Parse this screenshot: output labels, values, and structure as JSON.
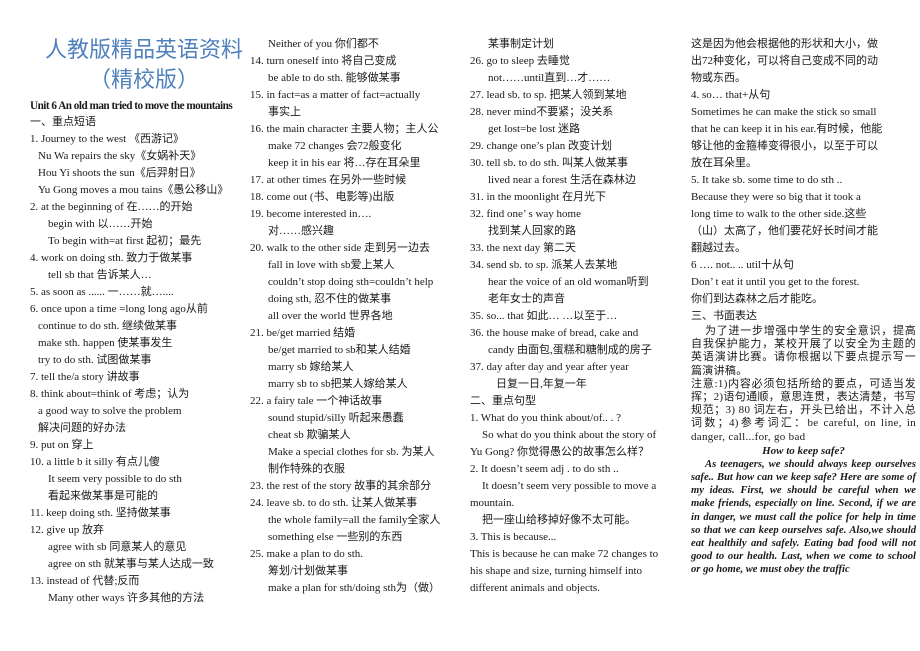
{
  "header": {
    "title": "人教版精品英语资料",
    "subtitle": "（精校版）",
    "unit_title": "Unit 6 An old man tried to move the mountains"
  },
  "colors": {
    "title": "#4f81bd",
    "text": "#1a1a1a"
  },
  "column1": [
    {
      "text": "一、重点短语",
      "indent": 0
    },
    {
      "text": "1. Journey to the west  《西游记》",
      "indent": 0
    },
    {
      "text": "Nu Wa repairs the sky《女娲补天》",
      "indent": 1
    },
    {
      "text": "Hou Yi shoots the sun《后羿射日》",
      "indent": 1
    },
    {
      "text": "Yu Gong moves a mou tains《愚公移山》",
      "indent": 1
    },
    {
      "text": "2. at the beginning of  在……的开始",
      "indent": 0
    },
    {
      "text": "begin with  以……开始",
      "indent": 2
    },
    {
      "text": "To begin with=at first  起初；最先",
      "indent": 2
    },
    {
      "text": "4. work on doing sth. 致力于做某事",
      "indent": 0
    },
    {
      "text": "tell sb that  告诉某人…",
      "indent": 2
    },
    {
      "text": "5. as soon as ......  一……就…....",
      "indent": 0
    },
    {
      "text": "6. once upon a time =long long ago从前",
      "indent": 0
    },
    {
      "text": "continue to do sth.  继续做某事",
      "indent": 1
    },
    {
      "text": "make sth. happen  使某事发生",
      "indent": 1
    },
    {
      "text": "try to do sth.  试图做某事",
      "indent": 1
    },
    {
      "text": "7. tell the/a story  讲故事",
      "indent": 0
    },
    {
      "text": "8. think about=think of  考虑；认为",
      "indent": 0
    },
    {
      "text": "a good way to solve the problem",
      "indent": 1
    },
    {
      "text": "解决问题的好办法",
      "indent": 1
    },
    {
      "text": "9. put on  穿上",
      "indent": 0
    },
    {
      "text": "10. a little b it silly  有点儿傻",
      "indent": 0
    },
    {
      "text": "It seem very possible to do sth",
      "indent": 2
    },
    {
      "text": "看起来做某事是可能的",
      "indent": 2
    },
    {
      "text": "11. keep doing sth.  坚持做某事",
      "indent": 0
    },
    {
      "text": "12. give up  放弃",
      "indent": 0
    },
    {
      "text": "agree with sb  同意某人的意见",
      "indent": 2
    },
    {
      "text": "agree on sth  就某事与某人达成一致",
      "indent": 2
    },
    {
      "text": "13. instead of  代替;反而",
      "indent": 0
    },
    {
      "text": "Many other ways  许多其他的方法",
      "indent": 2
    }
  ],
  "column2": [
    {
      "text": "Neither of you  你们都不",
      "indent": 1
    },
    {
      "text": "14. turn oneself into  将自己变成",
      "indent": 0
    },
    {
      "text": "be able to do sth.  能够做某事",
      "indent": 2
    },
    {
      "text": "15. in fact=as a matter of fact=actually",
      "indent": 0
    },
    {
      "text": "事实上",
      "indent": 1
    },
    {
      "text": "16. the main character  主要人物；主人公",
      "indent": 0
    },
    {
      "text": "make 72 changes  会72般变化",
      "indent": 1
    },
    {
      "text": "keep it in his ear  将…存在耳朵里",
      "indent": 1
    },
    {
      "text": "17. at other times  在另外一些时候",
      "indent": 0
    },
    {
      "text": "18. come out (书、电影等)出版",
      "indent": 0
    },
    {
      "text": "19. become interested in….",
      "indent": 0
    },
    {
      "text": "对……感兴趣",
      "indent": 1
    },
    {
      "text": "20. walk to the other side  走到另一边去",
      "indent": 0
    },
    {
      "text": "fall in love with sb爱上某人",
      "indent": 1
    },
    {
      "text": "couldn’t stop doing sth=couldn’t help",
      "indent": 1
    },
    {
      "text": "doing sth,  忍不住的做某事",
      "indent": 1
    },
    {
      "text": "all over the world  世界各地",
      "indent": 1
    },
    {
      "text": "21. be/get married  结婚",
      "indent": 0
    },
    {
      "text": "be/get married to sb和某人结婚",
      "indent": 1
    },
    {
      "text": "marry sb  嫁给某人",
      "indent": 1
    },
    {
      "text": "marry sb to sb把某人嫁给某人",
      "indent": 1
    },
    {
      "text": "22. a fairy tale  一个神话故事",
      "indent": 0
    },
    {
      "text": "sound stupid/silly  听起来愚蠢",
      "indent": 1
    },
    {
      "text": "cheat sb  欺骗某人",
      "indent": 1
    },
    {
      "text": "Make a special clothes for sb.  为某人",
      "indent": 1
    },
    {
      "text": "制作特殊的衣服",
      "indent": 1
    },
    {
      "text": "23. the rest of the story  故事的其余部分",
      "indent": 0
    },
    {
      "text": "24. leave sb. to do sth.  让某人做某事",
      "indent": 0
    },
    {
      "text": "the whole family=all the family全家人",
      "indent": 1
    },
    {
      "text": "something else  一些别的东西",
      "indent": 1
    },
    {
      "text": "25. make a plan to do sth.",
      "indent": 0
    },
    {
      "text": "筹划/计划做某事",
      "indent": 1
    },
    {
      "text": "make a plan for sth/doing sth为（做）",
      "indent": 1
    }
  ],
  "column3": [
    {
      "text": "某事制定计划",
      "indent": 1
    },
    {
      "text": "26. go to sleep  去睡觉",
      "indent": 0
    },
    {
      "text": "not……until直到…才……",
      "indent": 1
    },
    {
      "text": "27. lead sb. to sp.  把某人领到某地",
      "indent": 0
    },
    {
      "text": "28. never mind不要紧；没关系",
      "indent": 0
    },
    {
      "text": "get lost=be lost  迷路",
      "indent": 1
    },
    {
      "text": "29. change one’s plan  改变计划",
      "indent": 0
    },
    {
      "text": "30. tell sb. to do sth.  叫某人做某事",
      "indent": 0
    },
    {
      "text": "lived near a forest  生活在森林边",
      "indent": 1
    },
    {
      "text": "31. in the moonlight  在月光下",
      "indent": 0
    },
    {
      "text": "32. find one’ s way home",
      "indent": 0
    },
    {
      "text": "找到某人回家的路",
      "indent": 1
    },
    {
      "text": "33. the next day  第二天",
      "indent": 0
    },
    {
      "text": "34. send sb. to sp.  派某人去某地",
      "indent": 0
    },
    {
      "text": "hear the voice of an old woman听到",
      "indent": 1
    },
    {
      "text": "老年女士的声音",
      "indent": 1
    },
    {
      "text": "35. so... that  如此… …以至于…",
      "indent": 0
    },
    {
      "text": "36. the house make of bread, cake and",
      "indent": 0
    },
    {
      "text": "candy 由面包,蛋糕和糖制成的房子",
      "indent": 1
    },
    {
      "text": "37. day after day and year after year",
      "indent": 0
    },
    {
      "text": "日复一日,年复一年",
      "indent": 3
    },
    {
      "text": "二、重点句型",
      "indent": 0
    },
    {
      "text": "1. What do you think about/of.. . ?",
      "indent": 0
    },
    {
      "text": "So what do you think about the story of",
      "indent": 4
    },
    {
      "text": "Yu Gong?  你觉得愚公的故事怎么样？",
      "indent": 0
    },
    {
      "text": "2. It doesn’t seem adj . to do sth ..",
      "indent": 0
    },
    {
      "text": "It doesn’t seem very possible to move a",
      "indent": 4
    },
    {
      "text": "mountain.",
      "indent": 0
    },
    {
      "text": "把一座山给移掉好像不太可能。",
      "indent": 4
    },
    {
      "text": "3. This is because...",
      "indent": 0
    },
    {
      "text": "This is because he can make 72 changes to",
      "indent": 0
    },
    {
      "text": "his shape and size, turning himself into",
      "indent": 0
    },
    {
      "text": "different animals and objects.",
      "indent": 0
    }
  ],
  "column4": {
    "lines": [
      "这是因为他会根据他的形状和大小，做",
      "出72种变化，可以将自己变成不同的动",
      "物或东西。",
      "4. so… that+从句",
      "Sometimes he can make the stick so small",
      "that he can keep it in his ear.有时候，他能",
      "够让他的金箍棒变得很小，以至于可以",
      "放在耳朵里。",
      "5. It take sb. some time to do sth ..",
      "Because they were so big that it took a",
      "long time to walk to the other side.这些",
      "（山）太高了，他们要花好长时间才能",
      "翻越过去。",
      "6 …. not.. .. util十从句",
      "Don’ t eat it until you get to the forest.",
      "你们到达森林之后才能吃。",
      "三、书面表达"
    ],
    "instruction": "为了进一步增强中学生的安全意识，提高自我保护能力，某校开展了以安全为主题的英语演讲比赛。请你根据以下要点提示写一篇演讲稿。",
    "notes": "注意:1)内容必须包括所给的要点，可适当发挥；2)语句通顺，意思连贯，表达清楚，书写规范；3) 80 词左右，开头已给出，不计入总词数；4)参考词汇：be careful, on line, in danger, call...for, go bad",
    "essay_title": "How to keep safe?",
    "essay_body": "As teenagers, we should always keep ourselves safe.. But how can we keep safe? Here are some of my ideas. First, we should be careful when we make friends, especially on line. Second, if we are in danger, we must call the police for help in time so that we can keep ourselves safe. Also,we should eat healthily and safely. Eating bad food   will not good to our health. Last, when we come to school or go home, we must obey the traffic"
  }
}
